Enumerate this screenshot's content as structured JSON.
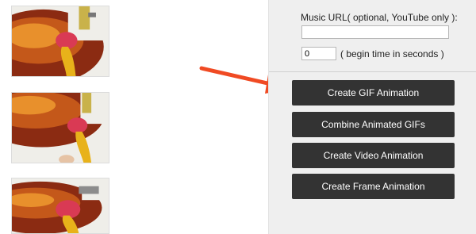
{
  "left_frames": [
    {
      "icon": "guitar-frame-1"
    },
    {
      "icon": "guitar-frame-2"
    },
    {
      "icon": "guitar-frame-3"
    }
  ],
  "options": {
    "music_url_label": "Music URL( optional, YouTube only ):",
    "music_url_value": "",
    "begin_time_value": "0",
    "begin_time_hint": "( begin time in seconds )"
  },
  "buttons": {
    "create_gif": "Create GIF Animation",
    "combine_gifs": "Combine Animated GIFs",
    "create_video": "Create Video Animation",
    "create_frame": "Create Frame Animation"
  },
  "colors": {
    "button_bg": "#333333",
    "panel_bg": "#efefef",
    "arrow": "#f04a23"
  }
}
